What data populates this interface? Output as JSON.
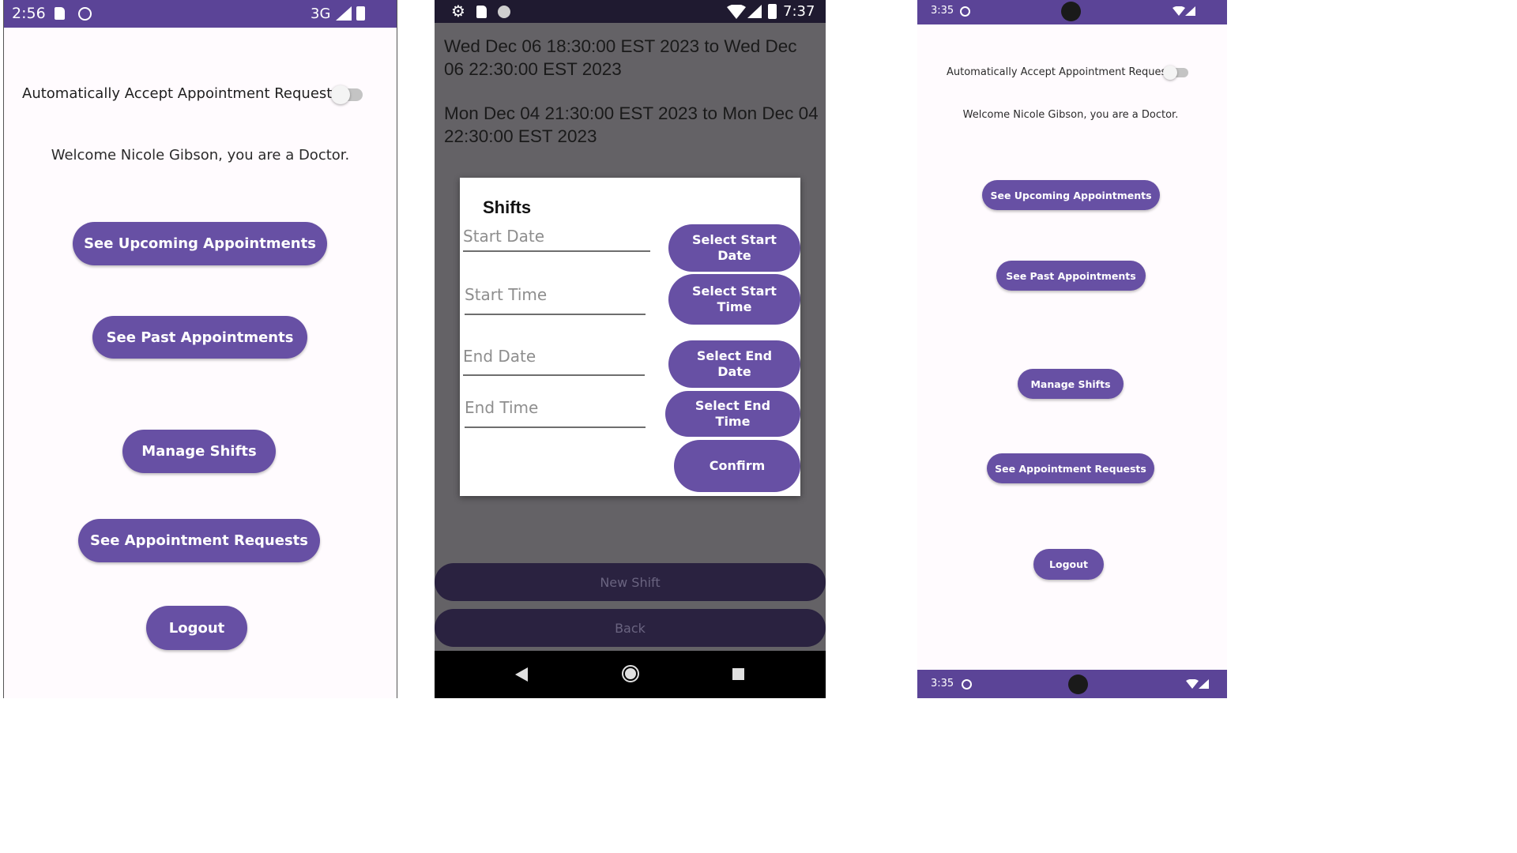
{
  "left_phone": {
    "status_bar": {
      "time": "2:56",
      "network": "3G"
    },
    "auto_accept_label": "Automatically Accept Appointment Requests",
    "welcome": "Welcome Nicole Gibson, you are a Doctor.",
    "buttons": {
      "upcoming": "See Upcoming Appointments",
      "past": "See Past Appointments",
      "shifts": "Manage Shifts",
      "requests": "See Appointment Requests",
      "logout": "Logout"
    }
  },
  "middle_phone": {
    "status_bar": {
      "time": "7:37"
    },
    "shift_list": [
      "Wed Dec 06 18:30:00 EST 2023 to Wed Dec 06 22:30:00 EST 2023",
      "Mon Dec 04 21:30:00 EST 2023 to Mon Dec 04 22:30:00 EST 2023"
    ],
    "dialog": {
      "title": "Shifts",
      "start_date_placeholder": "Start Date",
      "start_time_placeholder": "Start Time",
      "end_date_placeholder": "End Date",
      "end_time_placeholder": "End Time",
      "select_start_date": "Select Start\nDate",
      "select_start_time": "Select Start\nTime",
      "select_end_date": "Select End\nDate",
      "select_end_time": "Select End\nTime",
      "confirm": "Confirm"
    },
    "new_shift": "New Shift",
    "back": "Back"
  },
  "right_phone": {
    "status_bar": {
      "time": "3:35"
    },
    "bottom_bar": {
      "time": "3:35"
    },
    "auto_accept_label": "Automatically Accept Appointment Requests",
    "welcome": "Welcome Nicole Gibson, you are a Doctor.",
    "buttons": {
      "upcoming": "See Upcoming Appointments",
      "past": "See Past Appointments",
      "shifts": "Manage Shifts",
      "requests": "See Appointment Requests",
      "logout": "Logout"
    }
  },
  "colors": {
    "primary": "#6750a4",
    "status_bar": "#5b4497",
    "screen_bg": "#fffbfe",
    "scrim": "#646266",
    "dark_button": "#2a2240"
  }
}
